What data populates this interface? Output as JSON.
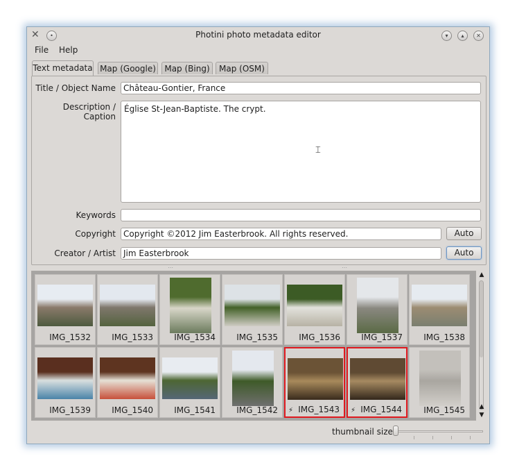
{
  "window": {
    "title": "Photini photo metadata editor"
  },
  "menu": [
    {
      "label": "File"
    },
    {
      "label": "Help"
    }
  ],
  "tabs": [
    {
      "label": "Text metadata"
    },
    {
      "label": "Map (Google)"
    },
    {
      "label": "Map (Bing)"
    },
    {
      "label": "Map (OSM)"
    }
  ],
  "form": {
    "title_label": "Title / Object Name",
    "title_value": "Château-Gontier, France",
    "description_label": "Description / Caption",
    "description_value": "Église St-Jean-Baptiste. The crypt.",
    "keywords_label": "Keywords",
    "keywords_value": "",
    "copyright_label": "Copyright",
    "copyright_value": "Copyright ©2012 Jim Easterbrook. All rights reserved.",
    "creator_label": "Creator / Artist",
    "creator_value": "Jim Easterbrook",
    "auto_label": "Auto"
  },
  "thumbnails": [
    {
      "name": "IMG_1532",
      "selected": false,
      "flash": false,
      "colors": [
        "#e7ecf2",
        "#8a7a6a",
        "#4d5a3f"
      ]
    },
    {
      "name": "IMG_1533",
      "selected": false,
      "flash": false,
      "colors": [
        "#e3e8ef",
        "#7f776c",
        "#54633f"
      ]
    },
    {
      "name": "IMG_1534",
      "selected": false,
      "flash": false,
      "colors": [
        "#4f6b2e",
        "#d8d6c8",
        "#6b7b5d"
      ]
    },
    {
      "name": "IMG_1535",
      "selected": false,
      "flash": false,
      "colors": [
        "#dde2e6",
        "#436128",
        "#cfccc4"
      ]
    },
    {
      "name": "IMG_1536",
      "selected": false,
      "flash": false,
      "colors": [
        "#3c5b25",
        "#e2e2dc",
        "#b7b2a5"
      ]
    },
    {
      "name": "IMG_1537",
      "selected": false,
      "flash": false,
      "colors": [
        "#e4e7ea",
        "#8a8880",
        "#5a6a45"
      ]
    },
    {
      "name": "IMG_1538",
      "selected": false,
      "flash": false,
      "colors": [
        "#e6ebf0",
        "#9c8c72",
        "#7a7f70"
      ]
    },
    {
      "name": "IMG_1539",
      "selected": false,
      "flash": false,
      "colors": [
        "#5a2f1f",
        "#d9dfdf",
        "#4a83a8"
      ]
    },
    {
      "name": "IMG_1540",
      "selected": false,
      "flash": false,
      "colors": [
        "#5e3420",
        "#e6e1d6",
        "#c7503a"
      ]
    },
    {
      "name": "IMG_1541",
      "selected": false,
      "flash": false,
      "colors": [
        "#e8ecf1",
        "#4d6633",
        "#556676"
      ]
    },
    {
      "name": "IMG_1542",
      "selected": false,
      "flash": false,
      "colors": [
        "#e4e8ee",
        "#3e5a28",
        "#6f6f6f"
      ]
    },
    {
      "name": "IMG_1543",
      "selected": true,
      "flash": true,
      "colors": [
        "#6b5336",
        "#a88a5c",
        "#3a2b1c"
      ]
    },
    {
      "name": "IMG_1544",
      "selected": true,
      "flash": true,
      "colors": [
        "#5f4a33",
        "#a68a61",
        "#33271b"
      ]
    },
    {
      "name": "IMG_1545",
      "selected": false,
      "flash": false,
      "colors": [
        "#c3c0bb",
        "#a9a6a0",
        "#d2cfca"
      ]
    }
  ],
  "flash_symbol": "⚡",
  "thumbnail_size_label": "thumbnail size:",
  "thumbnail_size_value": 0
}
